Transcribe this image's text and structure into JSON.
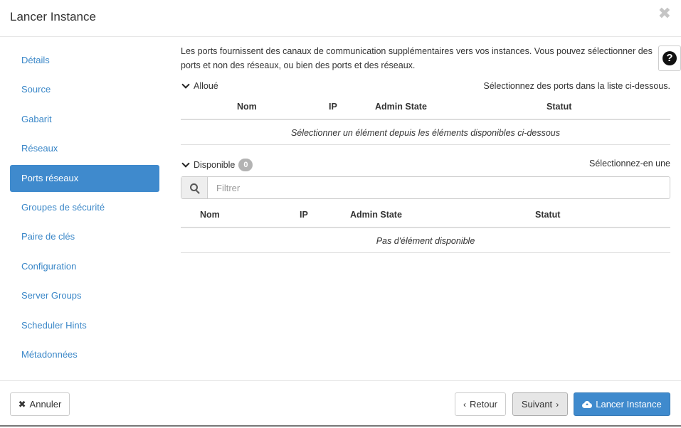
{
  "modal": {
    "title": "Lancer Instance",
    "close_symbol": "✖"
  },
  "sidebar": {
    "items": [
      {
        "label": "Détails"
      },
      {
        "label": "Source"
      },
      {
        "label": "Gabarit"
      },
      {
        "label": "Réseaux"
      },
      {
        "label": "Ports réseaux",
        "active": true
      },
      {
        "label": "Groupes de sécurité"
      },
      {
        "label": "Paire de clés"
      },
      {
        "label": "Configuration"
      },
      {
        "label": "Server Groups"
      },
      {
        "label": "Scheduler Hints"
      },
      {
        "label": "Métadonnées"
      }
    ]
  },
  "content": {
    "intro": "Les ports fournissent des canaux de communication supplémentaires vers vos instances. Vous pouvez sélectionner des ports et non des réseaux, ou bien des ports et des réseaux.",
    "help_symbol": "?",
    "allocated": {
      "label": "Alloué",
      "hint": "Sélectionnez des ports dans la liste ci-dessous.",
      "columns": [
        "Nom",
        "IP",
        "Admin State",
        "Statut"
      ],
      "empty_message": "Sélectionner un élément depuis les éléments disponibles ci-dessous"
    },
    "available": {
      "label": "Disponible",
      "count": "0",
      "hint": "Sélectionnez-en une",
      "filter_placeholder": "Filtrer",
      "columns": [
        "Nom",
        "IP",
        "Admin State",
        "Statut"
      ],
      "empty_message": "Pas d'élément disponible"
    }
  },
  "footer": {
    "cancel_label": "Annuler",
    "back_label": "Retour",
    "next_label": "Suivant",
    "launch_label": "Lancer Instance"
  },
  "colors": {
    "accent": "#3f8acd",
    "link": "#3a87c8"
  }
}
